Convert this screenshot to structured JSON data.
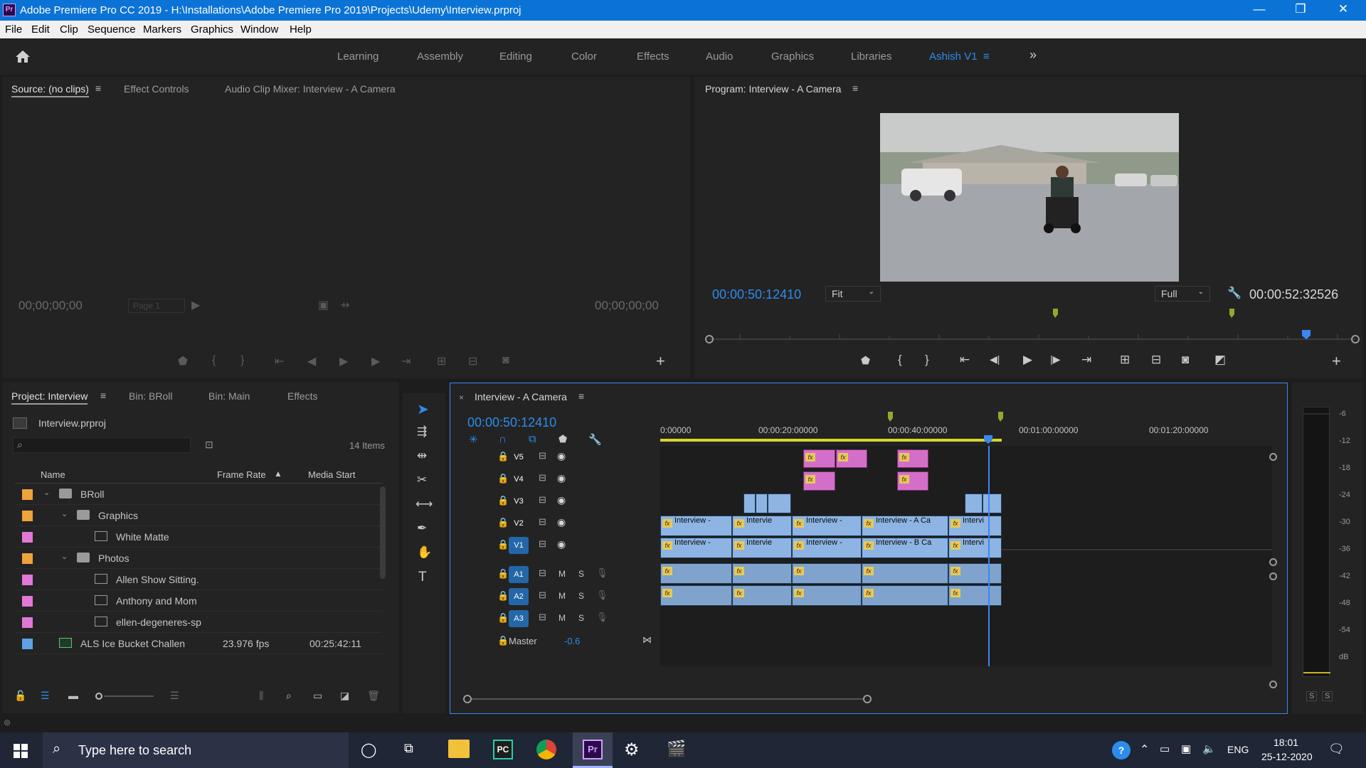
{
  "titlebar": {
    "app_badge": "Pr",
    "title": "Adobe Premiere Pro CC 2019 - H:\\Installations\\Adobe Premiere Pro 2019\\Projects\\Udemy\\Interview.prproj",
    "minimize": "—",
    "restore": "❐",
    "close": "✕"
  },
  "menu": [
    "File",
    "Edit",
    "Clip",
    "Sequence",
    "Markers",
    "Graphics",
    "Window",
    "Help"
  ],
  "workspaces": {
    "items": [
      "Learning",
      "Assembly",
      "Editing",
      "Color",
      "Effects",
      "Audio",
      "Graphics",
      "Libraries"
    ],
    "active": "Ashish V1",
    "overflow": "»"
  },
  "source_panel": {
    "tabs": [
      "Source: (no clips)",
      "Effect Controls",
      "Audio Clip Mixer: Interview - A Camera"
    ],
    "timecode_left": "00;00;00;00",
    "timecode_right": "00;00;00;00",
    "page": "Page 1"
  },
  "program_panel": {
    "title": "Program: Interview - A Camera",
    "timecode": "00:00:50:12410",
    "zoom": "Fit",
    "resolution": "Full",
    "duration": "00:00:52:32526"
  },
  "project_panel": {
    "tabs": [
      "Project: Interview",
      "Bin: BRoll",
      "Bin: Main",
      "Effects"
    ],
    "file": "Interview.prproj",
    "item_count": "14 Items",
    "columns": [
      "Name",
      "Frame Rate",
      "Media Start"
    ],
    "rows": [
      {
        "name": "BRoll",
        "color": "#f0a33a",
        "frame_rate": "",
        "media_start": ""
      },
      {
        "name": "Graphics",
        "color": "#f0a33a",
        "frame_rate": "",
        "media_start": ""
      },
      {
        "name": "White Matte",
        "color": "#e178d8",
        "frame_rate": "",
        "media_start": ""
      },
      {
        "name": "Photos",
        "color": "#f0a33a",
        "frame_rate": "",
        "media_start": ""
      },
      {
        "name": "Allen Show Sitting.",
        "color": "#e178d8",
        "frame_rate": "",
        "media_start": ""
      },
      {
        "name": "Anthony and Mom",
        "color": "#e178d8",
        "frame_rate": "",
        "media_start": ""
      },
      {
        "name": "ellen-degeneres-sp",
        "color": "#e178d8",
        "frame_rate": "",
        "media_start": ""
      },
      {
        "name": "ALS Ice Bucket Challen",
        "color": "#5ea2e5",
        "frame_rate": "23.976 fps",
        "media_start": "00:25:42:11"
      }
    ]
  },
  "timeline": {
    "sequence": "Interview - A Camera",
    "timecode": "00:00:50:12410",
    "ruler": [
      "0:00000",
      "00:00:20:00000",
      "00:00:40:00000",
      "00:01:00:00000",
      "00:01:20:00000"
    ],
    "video_tracks": [
      "V5",
      "V4",
      "V3",
      "V2",
      "V1"
    ],
    "audio_tracks": [
      "A1",
      "A2",
      "A3"
    ],
    "mute": "M",
    "solo": "S",
    "master": {
      "label": "Master",
      "value": "-0.6"
    },
    "v2_clips": [
      "Interview -",
      "Intervie",
      "Interview -",
      "Interview - A Ca",
      "Intervi"
    ],
    "v1_clips": [
      "Interview -",
      "Intervie",
      "Interview -",
      "Interview - B Ca",
      "Intervi"
    ],
    "fx": "fx"
  },
  "audio_meter": {
    "scale": [
      "-6",
      "-12",
      "-18",
      "-24",
      "-30",
      "-36",
      "-42",
      "-48",
      "-54",
      "dB"
    ],
    "solo": [
      "S",
      "S"
    ]
  },
  "taskbar": {
    "search_placeholder": "Type here to search",
    "lang": "ENG",
    "time": "18:01",
    "date": "25-12-2020"
  },
  "colors": {
    "accent_blue": "#2d8ceb",
    "titlebar": "#0b73d6",
    "playhead": "#3b87f0",
    "work_area": "#d8d62c"
  }
}
